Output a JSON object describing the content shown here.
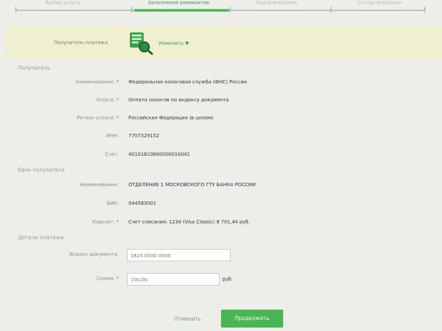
{
  "stepper": {
    "steps": [
      {
        "label": "Выбор услуги",
        "active": false
      },
      {
        "label": "Заполнение реквизитов",
        "active": true
      },
      {
        "label": "Подтверждение",
        "active": false
      },
      {
        "label": "Статус операции",
        "active": false
      }
    ]
  },
  "merchant": {
    "label": "Получатель платежа",
    "change_label": "Изменить ▼"
  },
  "sections": {
    "recipient": "Получатель",
    "recipient_bank": "Банк получателя",
    "details": "Детали платежа"
  },
  "recipient_fields": [
    {
      "label": "Наименование:",
      "required": true,
      "value": "Федеральная налоговая служба (ФНС) России"
    },
    {
      "label": "Услуга:",
      "required": true,
      "value": "Оплата налогов по индексу документа"
    },
    {
      "label": "Регион услуги:",
      "required": true,
      "value": "Российская Федерация (в целом)"
    },
    {
      "label": "ИНН:",
      "required": false,
      "value": "7707329152"
    },
    {
      "label": "Счет:",
      "required": false,
      "value": "40101810800000010041"
    }
  ],
  "bank_fields": [
    {
      "label": "Наименование:",
      "required": false,
      "value": "ОТДЕЛЕНИЕ 1 МОСКОВСКОГО ГТУ БАНКА РОССИИ"
    },
    {
      "label": "БИК:",
      "required": false,
      "value": "044583001"
    },
    {
      "label": "Корсчет:",
      "required": true,
      "value": "Счет списания: 1234 (Visa Classic) 8 701,44 руб."
    }
  ],
  "details": {
    "payer_doc_label": "Индекс документа:",
    "payer_doc_value": "1824 0000 0000",
    "amount_label": "Сумма:",
    "amount_value": "100,00",
    "currency": "руб."
  },
  "actions": {
    "cancel": "Отменить",
    "continue": "Продолжить"
  },
  "colors": {
    "accent": "#49b553",
    "band": "#f1efd2",
    "required": "#d34b3b"
  }
}
